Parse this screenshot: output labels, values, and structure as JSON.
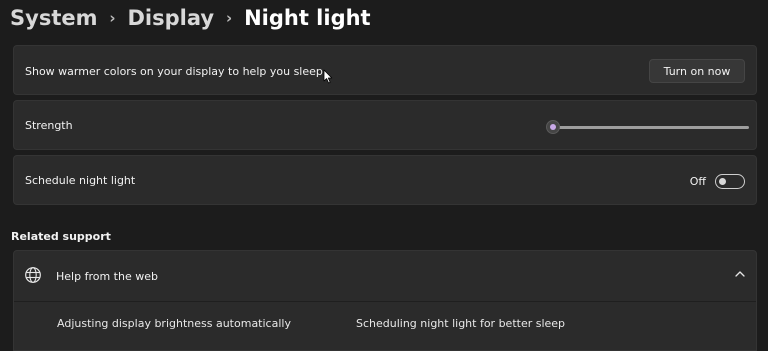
{
  "breadcrumb": {
    "items": [
      "System",
      "Display",
      "Night light"
    ],
    "separator": "›"
  },
  "night_light_row": {
    "description": "Show warmer colors on your display to help you sleep",
    "button_label": "Turn on now"
  },
  "strength_row": {
    "label": "Strength",
    "value_fraction": 0.0
  },
  "schedule_row": {
    "label": "Schedule night light",
    "state_label": "Off",
    "enabled": false
  },
  "related_support": {
    "heading": "Related support",
    "help_item": {
      "label": "Help from the web",
      "expanded": true,
      "icon": "globe-icon",
      "chevron_icon": "chevron-up-icon"
    },
    "links": [
      "Adjusting display brightness automatically",
      "Scheduling night light for better sleep"
    ]
  },
  "colors": {
    "background": "#1c1c1c",
    "card": "#2b2b2b",
    "accent": "#c9a9e8"
  }
}
